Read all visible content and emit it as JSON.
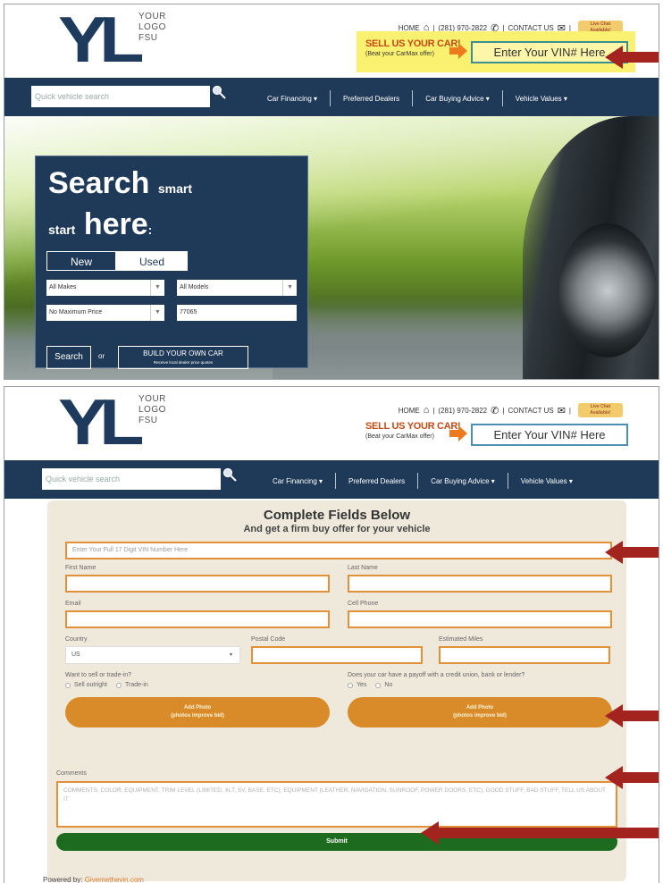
{
  "logo": {
    "mark": "YL",
    "line1": "YOUR",
    "line2": "LOGO",
    "line3": "FSU"
  },
  "toplinks": {
    "home": "HOME",
    "phone": "(281) 970-2822",
    "contact": "CONTACT US",
    "livechat1": "Live Chat",
    "livechat2": "Available!"
  },
  "sell": {
    "title": "SELL US YOUR CAR!",
    "sub_top": "(Beat your CarMax offer)",
    "sub_bottom": "(Beat your CarMax offer)",
    "vin_button": "Enter Your VIN# Here"
  },
  "nav": {
    "search_placeholder": "Quick vehicle search",
    "items": [
      "Car Financing ▾",
      "Preferred Dealers",
      "Car Buying Advice ▾",
      "Vehicle Values ▾"
    ]
  },
  "hero": {
    "headline1": "Search",
    "headline1_small": "smart",
    "headline2_small": "start",
    "headline2": "here",
    "headline2_colon": ":",
    "tab_new": "New",
    "tab_used": "Used",
    "makes": "All Makes",
    "models": "All Models",
    "price": "No Maximum Price",
    "zip": "77065",
    "search_btn": "Search",
    "or": "or",
    "build_title": "BUILD YOUR OWN CAR",
    "build_sub": "Receive local dealer price quotes"
  },
  "form": {
    "title": "Complete Fields Below",
    "subtitle": "And get a firm buy offer for your vehicle",
    "vin_placeholder": "Enter Your Full 17 Digit VIN Number Here",
    "first_name": "First Name",
    "last_name": "Last Name",
    "email": "Email",
    "cell_phone": "Cell Phone",
    "country": "Country",
    "country_value": "US",
    "postal_code": "Postal Code",
    "estimated_miles": "Estimated Miles",
    "sell_q": "Want to sell or trade-in?",
    "sell_opt1": "Sell outright",
    "sell_opt2": "Trade-in",
    "payoff_q": "Does your car have a payoff with a credit union, bank or lender?",
    "payoff_yes": "Yes",
    "payoff_no": "No",
    "add_photo": "Add Photo",
    "photo_note": "(photos improve bid)",
    "comments_label": "Comments",
    "comments_placeholder": "COMMENTS, COLOR, EQUIPMENT, TRIM LEVEL (LIMITED, XLT, SV, BASE, ETC), EQUIPMENT (LEATHER, NAVIGATION, SUNROOF, POWER DOORS, ETC), GOOD STUFF, BAD STUFF, TELL US ABOUT IT",
    "submit": "Submit"
  },
  "powered": {
    "label": "Powered by:",
    "link": "Givemethevin.com"
  },
  "colors": {
    "navy": "#1f3a58",
    "orange": "#e0913a",
    "green": "#1d6b1f",
    "arrow_red": "#a3241f",
    "highlight": "#fbf170"
  }
}
